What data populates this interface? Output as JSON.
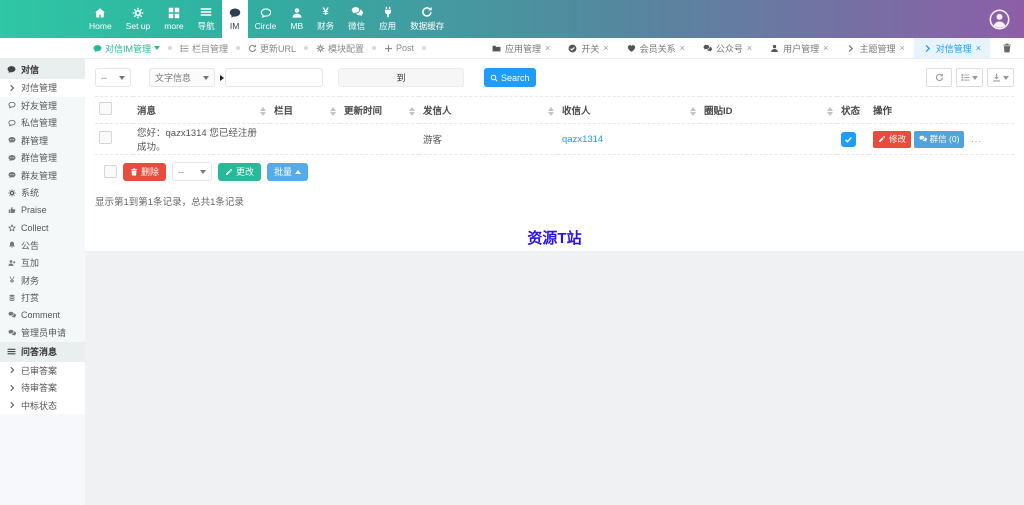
{
  "colors": {
    "navbar_gradient_start": "#2fc7a5",
    "navbar_gradient_end": "#8d5ea7",
    "accent_teal": "#26b99a",
    "link_blue": "#1c9dff",
    "danger_red": "#e74c3c",
    "info_blue": "#51a3dd",
    "batch_blue": "#55aae9",
    "active_tab_bg": "#e7f4fe",
    "watermark_blue": "#2a12ee"
  },
  "topnav": {
    "items": [
      {
        "label": "Home",
        "icon": "home-icon"
      },
      {
        "label": "Set up",
        "icon": "cogs-icon"
      },
      {
        "label": "more",
        "icon": "grid-icon"
      },
      {
        "label": "导航",
        "icon": "bars-icon"
      },
      {
        "label": "IM",
        "icon": "comment-icon",
        "active": true
      },
      {
        "label": "Circle",
        "icon": "comment-outline-icon"
      },
      {
        "label": "MB",
        "icon": "user-icon"
      },
      {
        "label": "财务",
        "icon": "yen-icon",
        "glyph": "¥"
      },
      {
        "label": "微信",
        "icon": "comments-icon"
      },
      {
        "label": "应用",
        "icon": "plug-icon"
      },
      {
        "label": "数据缓存",
        "icon": "refresh-icon"
      }
    ],
    "avatar_icon": "user-avatar-icon"
  },
  "breadcrumb": {
    "items": [
      {
        "label": "对信IM管理",
        "icon": "comment-icon",
        "active": true
      },
      {
        "label": "栏目管理",
        "icon": "list-icon"
      },
      {
        "label": "更新URL",
        "icon": "refresh-icon"
      },
      {
        "label": "模块配置",
        "icon": "gear-icon"
      },
      {
        "label": "Post",
        "icon": "plus-icon"
      }
    ]
  },
  "tabs": {
    "close_glyph": "×",
    "items": [
      {
        "label": "应用管理",
        "icon": "folder-icon"
      },
      {
        "label": "开关",
        "icon": "check-circle-icon"
      },
      {
        "label": "会员关系",
        "icon": "heart-icon"
      },
      {
        "label": "公众号",
        "icon": "comments-icon"
      },
      {
        "label": "用户管理",
        "icon": "user-icon"
      },
      {
        "label": "主题管理",
        "icon": "chevron-right-icon"
      },
      {
        "label": "对信管理",
        "icon": "chevron-right-icon",
        "active": true
      }
    ],
    "trash_icon": "trash-icon"
  },
  "sidebar": {
    "items": [
      {
        "type": "header",
        "label": "对信",
        "icon": "comment-icon"
      },
      {
        "type": "item",
        "label": "对信管理",
        "icon": "chevron-right-icon",
        "active": true
      },
      {
        "type": "item",
        "label": "好友管理",
        "icon": "comment-outline-icon"
      },
      {
        "type": "item",
        "label": "私信管理",
        "icon": "comment-outline-icon"
      },
      {
        "type": "item",
        "label": "群管理",
        "icon": "comment-dots-icon"
      },
      {
        "type": "item",
        "label": "群信管理",
        "icon": "comment-dots-icon"
      },
      {
        "type": "item",
        "label": "群友管理",
        "icon": "comment-dots-icon"
      },
      {
        "type": "item",
        "label": "系统",
        "icon": "gear-icon"
      },
      {
        "type": "item",
        "label": "Praise",
        "icon": "thumbs-up-icon"
      },
      {
        "type": "item",
        "label": "Collect",
        "icon": "star-icon"
      },
      {
        "type": "item",
        "label": "公告",
        "icon": "bell-icon"
      },
      {
        "type": "item",
        "label": "互加",
        "icon": "user-plus-icon"
      },
      {
        "type": "item",
        "label": "财务",
        "icon": "yen-icon",
        "glyph": "¥"
      },
      {
        "type": "item",
        "label": "打赏",
        "icon": "coins-icon"
      },
      {
        "type": "item",
        "label": "Comment",
        "icon": "comments-icon"
      },
      {
        "type": "item",
        "label": "管理员申请",
        "icon": "comments-icon"
      },
      {
        "type": "header",
        "label": "问答消息",
        "icon": "bars-icon"
      },
      {
        "type": "subitem",
        "label": "已审答案",
        "icon": "chevron-right-icon"
      },
      {
        "type": "subitem",
        "label": "待审答案",
        "icon": "chevron-right-icon"
      },
      {
        "type": "subitem",
        "label": "中标状态",
        "icon": "chevron-right-icon"
      }
    ]
  },
  "toolbar": {
    "filter_select": "--",
    "type_select": "文字信息",
    "keyword_value": "",
    "range_value": "到",
    "search_label": "Search",
    "right_buttons": [
      "refresh-icon",
      "list-icon",
      "export-icon"
    ]
  },
  "table": {
    "columns": [
      "消息",
      "栏目",
      "更新时间",
      "发信人",
      "收信人",
      "圈贴ID",
      "状态",
      "操作"
    ],
    "rows": [
      {
        "message": "您好：qazx1314 您已经注册成功。",
        "column": "",
        "update_time": "",
        "sender": "游客",
        "receiver": "qazx1314",
        "circle_id": "",
        "status_checked": true,
        "action_edit": "修改",
        "action_group": "群信 (0)",
        "action_more": "..."
      }
    ]
  },
  "bulkbar": {
    "delete_label": "删除",
    "select_value": "--",
    "change_label": "更改",
    "batch_label": "批量"
  },
  "pagination": {
    "summary": "显示第1到第1条记录，总共1条记录"
  },
  "watermark": {
    "text": "资源T站"
  }
}
